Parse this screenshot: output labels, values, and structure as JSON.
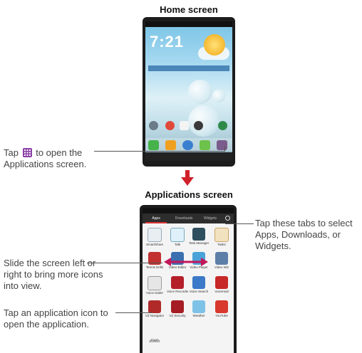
{
  "home": {
    "title": "Home screen",
    "clock": "7:21",
    "callout": [
      "Tap",
      "to open the",
      "Applications screen."
    ]
  },
  "applications": {
    "title": "Applications screen",
    "callout_tabs": "Tap these tabs to select Apps, Downloads, or Widgets.",
    "callout_slide": "Slide the screen left or right to bring more icons into view.",
    "callout_tap": "Tap an application icon to open the application.",
    "tabs": [
      "Apps",
      "Downloads",
      "Widgets"
    ],
    "apps": [
      "SmartShare",
      "Talk",
      "Task Manager",
      "Tasks",
      "Tennis Drills",
      "Video Editor",
      "Video Player",
      "Video Wiz",
      "Voice Dialer",
      "Voice Recorder",
      "Voice Search",
      "Voicemail",
      "VZ Navigator",
      "VZ Security",
      "Weather",
      "YouTube",
      "Zoom",
      "Zomerz"
    ]
  },
  "colors": {
    "arrow": "#d0212a",
    "leader_line": "#555555",
    "grid_icon": "#8a3fa6"
  },
  "icons": [
    "apps-grid-icon",
    "down-arrow-icon",
    "double-arrow-icon"
  ]
}
